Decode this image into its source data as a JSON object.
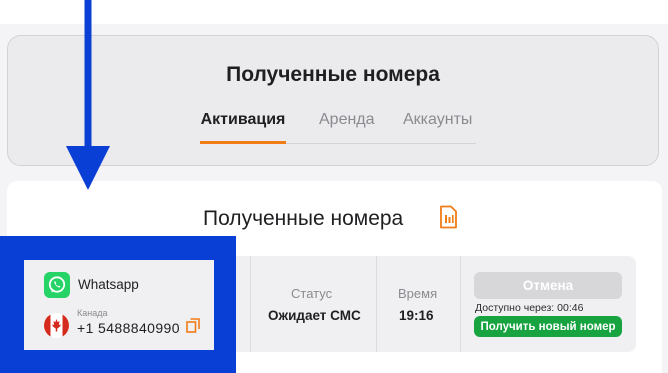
{
  "header": {
    "title": "Полученные номера",
    "tabs": [
      {
        "label": "Активация",
        "active": true
      },
      {
        "label": "Аренда",
        "active": false
      },
      {
        "label": "Аккаунты",
        "active": false
      }
    ]
  },
  "content": {
    "title": "Полученные номера",
    "title_icon": "sim-card-icon"
  },
  "order": {
    "service": {
      "name": "Whatsapp",
      "icon": "whatsapp-icon"
    },
    "country": {
      "name": "Канада",
      "flag": "canada-flag-icon"
    },
    "phone": "+1 5488840990",
    "status_label": "Статус",
    "status_value": "Ожидает СМС",
    "time_label": "Время",
    "time_value": "19:16",
    "cancel_label": "Отмена",
    "available_text": "Доступно через:  00:46",
    "new_number_label": "Получить новый номер"
  },
  "colors": {
    "accent": "#f07c16",
    "green": "#17a340",
    "annotation_blue": "#0a3fd6"
  }
}
